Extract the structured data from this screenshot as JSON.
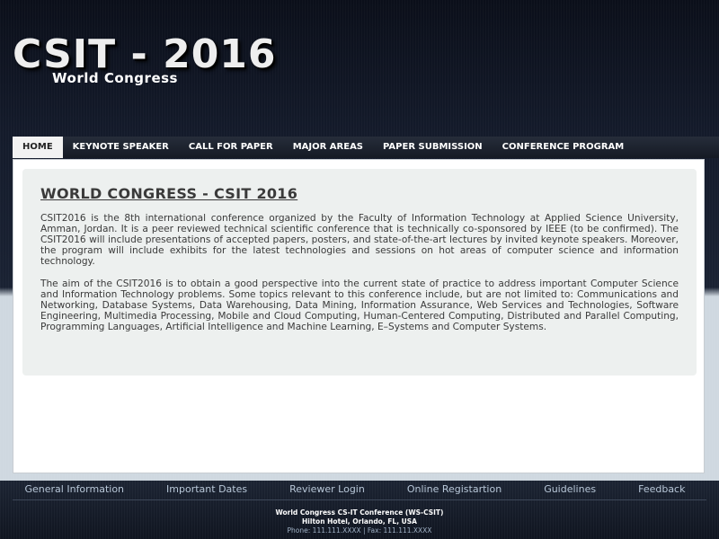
{
  "header": {
    "title": "CSIT - 2016",
    "subtitle": "World Congress"
  },
  "nav": {
    "items": [
      {
        "label": "HOME",
        "active": true
      },
      {
        "label": "KEYNOTE SPEAKER"
      },
      {
        "label": "CALL FOR PAPER"
      },
      {
        "label": "MAJOR AREAS"
      },
      {
        "label": "PAPER SUBMISSION"
      },
      {
        "label": "CONFERENCE PROGRAM"
      }
    ]
  },
  "main": {
    "heading": "WORLD CONGRESS - CSIT 2016",
    "paragraphs": [
      "CSIT2016 is the 8th international conference organized by the Faculty of Information Technology at Applied Science University, Amman, Jordan. It is a peer reviewed technical scientific conference that is technically co-sponsored by IEEE (to be confirmed). The CSIT2016 will include presentations of accepted papers, posters, and state-of-the-art lectures by invited keynote speakers. Moreover, the program will include exhibits for the latest technologies and sessions on hot areas of computer science and information technology.",
      "The aim of the CSIT2016 is to obtain a good perspective into the current state of practice to address important Computer Science and Information Technology problems. Some topics relevant to this conference include, but are not limited to: Communications and Networking, Database Systems, Data Warehousing, Data Mining, Information Assurance, Web Services and Technologies, Software Engineering, Multimedia Processing, Mobile and Cloud Computing, Human-Centered Computing, Distributed and Parallel Computing, Programming Languages, Artificial Intelligence and Machine Learning, E–Systems and Computer Systems."
    ]
  },
  "footer": {
    "links": [
      "General Information",
      "Important Dates",
      "Reviewer Login",
      "Online Registartion",
      "Guidelines",
      "Feedback"
    ],
    "conference_name": "World Congress CS-IT Conference (WS-CSIT)",
    "location": "Hilton Hotel, Orlando, FL, USA",
    "contact": "Phone: 111.111.XXXX | Fax: 111.111.XXXX"
  },
  "colors": {
    "header_bg": "#0b0f1a",
    "nav_bg": "#1c222d",
    "nav_active_bg": "#f2f2f2",
    "content_bg": "#edf0ef",
    "footer_link": "#b8c7d8"
  }
}
